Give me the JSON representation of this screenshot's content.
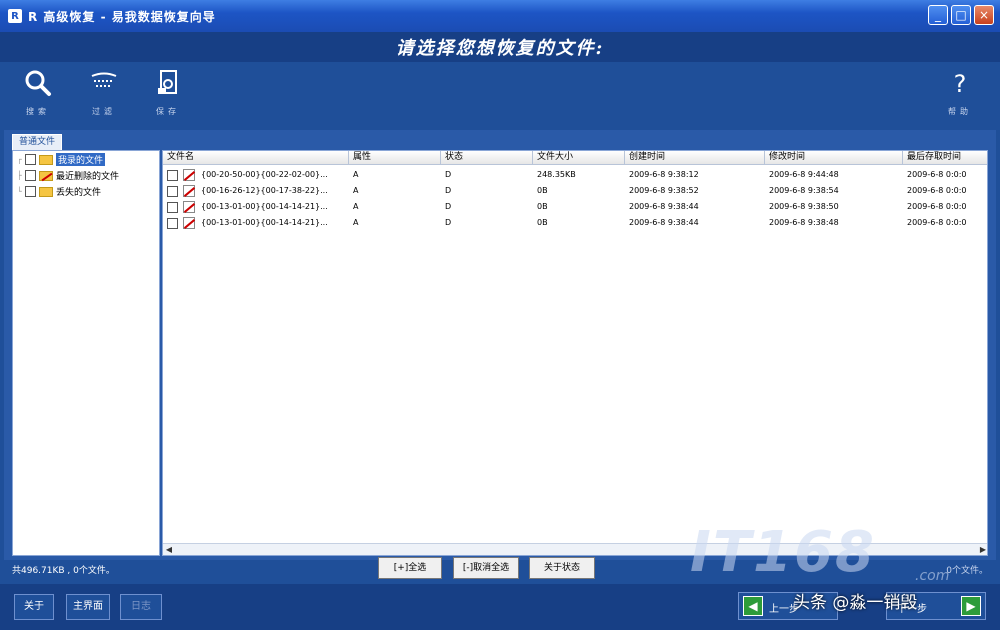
{
  "window": {
    "title": "R 高级恢复 - 易我数据恢复向导",
    "app_icon_letter": "R",
    "minimize": "_",
    "maximize": "□",
    "close": "×"
  },
  "header": {
    "heading": "请选择您想恢复的文件:"
  },
  "toolbar": {
    "search_label": "搜索",
    "filter_label": "过滤",
    "save_label": "保存",
    "help_label": "帮助"
  },
  "tabs": [
    "普通文件"
  ],
  "tree": {
    "items": [
      {
        "label": "我录的文件",
        "selected": true
      },
      {
        "label": "最近删除的文件",
        "selected": false
      },
      {
        "label": "丢失的文件",
        "selected": false
      }
    ]
  },
  "table": {
    "columns": [
      "文件名",
      "属性",
      "状态",
      "文件大小",
      "创建时间",
      "修改时间",
      "最后存取时间"
    ],
    "rows": [
      [
        "{00-20-50-00}{00-22-02-00}...",
        "A",
        "D",
        "248.35KB",
        "2009-6-8 9:38:12",
        "2009-6-8 9:44:48",
        "2009-6-8 0:0:0"
      ],
      [
        "{00-16-26-12}{00-17-38-22}...",
        "A",
        "D",
        "0B",
        "2009-6-8 9:38:52",
        "2009-6-8 9:38:54",
        "2009-6-8 0:0:0"
      ],
      [
        "{00-13-01-00}{00-14-14-21}...",
        "A",
        "D",
        "0B",
        "2009-6-8 9:38:44",
        "2009-6-8 9:38:50",
        "2009-6-8 0:0:0"
      ],
      [
        "{00-13-01-00}{00-14-14-21}...",
        "A",
        "D",
        "0B",
        "2009-6-8 9:38:44",
        "2009-6-8 9:38:48",
        "2009-6-8 0:0:0"
      ]
    ]
  },
  "status": {
    "left": "共496.71KB , 0个文件。",
    "right": "0个文件。"
  },
  "buttons": {
    "select_all": "[+]全选",
    "deselect_all": "[-]取消全选",
    "about_status": "关于状态",
    "about": "关于",
    "main_menu": "主界面",
    "log": "日志",
    "prev": "上一步",
    "next": "下一步"
  },
  "watermark": {
    "text": "IT168",
    "subtext": ".com"
  },
  "overlay": {
    "text": "头条 @淼一销毁"
  }
}
